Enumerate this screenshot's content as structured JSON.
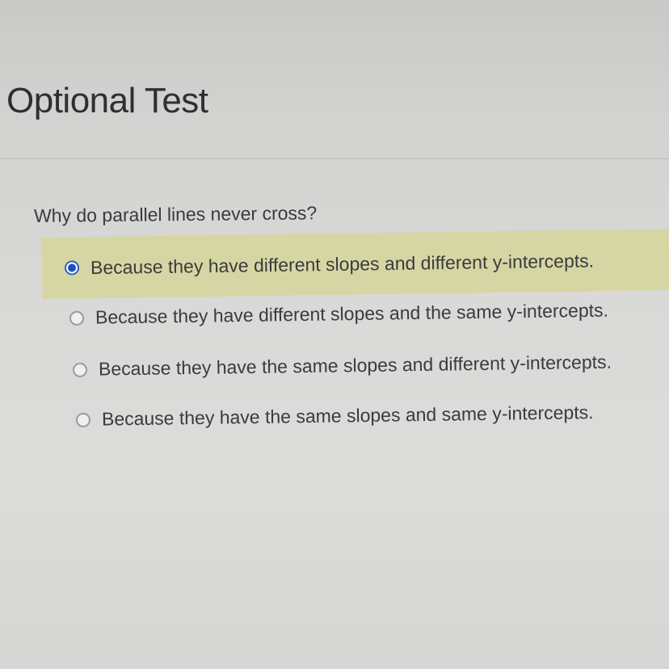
{
  "page": {
    "title": "Optional Test"
  },
  "question": {
    "text": "Why do parallel lines never cross?",
    "options": [
      {
        "label": "Because they have different slopes and different y-intercepts.",
        "selected": true
      },
      {
        "label": "Because they have different slopes and the same y-intercepts.",
        "selected": false
      },
      {
        "label": "Because they have the same slopes and different y-intercepts.",
        "selected": false
      },
      {
        "label": "Because they have the same slopes and same y-intercepts.",
        "selected": false
      }
    ]
  },
  "colors": {
    "selected_highlight": "#d6d6a4",
    "radio_checked": "#1f4fb8",
    "background": "#d9d9d7"
  }
}
